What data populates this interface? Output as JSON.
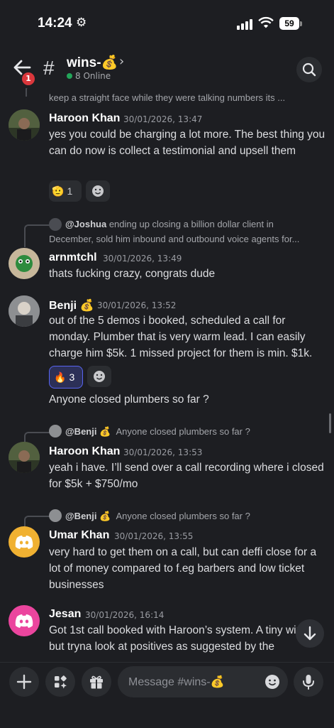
{
  "status": {
    "time": "14:24",
    "battery": "59"
  },
  "header": {
    "unread": "1",
    "channel": "wins-💰",
    "online": "8 Online"
  },
  "messages": {
    "top_snippet": "keep a straight face while they were talking numbers its ...",
    "m1": {
      "author": "Haroon Khan",
      "time": "30/01/2026, 13:47",
      "text": "yes you could be charging a lot more. The best thing you can do now is collect a testimonial and upsell them",
      "reaction_emoji": "🫡",
      "reaction_count": "1"
    },
    "m2": {
      "reply_user": "@Joshua",
      "reply_text": "ending up closing a billion dollar client in December, sold him inbound and outbound voice agents for...",
      "author": "arnmtchl",
      "time": "30/01/2026, 13:49",
      "text": "thats fucking crazy, congrats dude"
    },
    "m3": {
      "author": "Benji 💰",
      "time": "30/01/2026, 13:52",
      "text": "out of the 5 demos i booked, scheduled a call for monday. Plumber that is very warm lead. I can easily charge him $5k. 1 missed project for them is min. $1k.",
      "reaction_emoji": "🔥",
      "reaction_count": "3",
      "text2": "Anyone closed plumbers so far ?"
    },
    "m4": {
      "reply_user": "@Benji 💰",
      "reply_text": "Anyone closed plumbers so far ?",
      "author": "Haroon Khan",
      "time": "30/01/2026, 13:53",
      "text": "yeah i have. I’ll send over a call recording where i closed for $5k + $750/mo"
    },
    "m5": {
      "reply_user": "@Benji 💰",
      "reply_text": "Anyone closed plumbers so far ?",
      "author": "Umar Khan",
      "time": "30/01/2026, 13:55",
      "text": "very hard to get them on a call, but can deffi close for a lot of money compared to f.eg barbers and low ticket businesses"
    },
    "m6": {
      "author": "Jesan",
      "time": "30/01/2026, 16:14",
      "text": "Got 1st call booked with Haroon’s system. A tiny win, but tryna look at positives as suggested by the"
    }
  },
  "composer": {
    "placeholder": "Message #wins-💰"
  },
  "colors": {
    "accent": "#5865f2",
    "online": "#23a55a",
    "badge": "#da373c",
    "discord_yellow": "#f0b132",
    "discord_pink": "#eb459e"
  }
}
